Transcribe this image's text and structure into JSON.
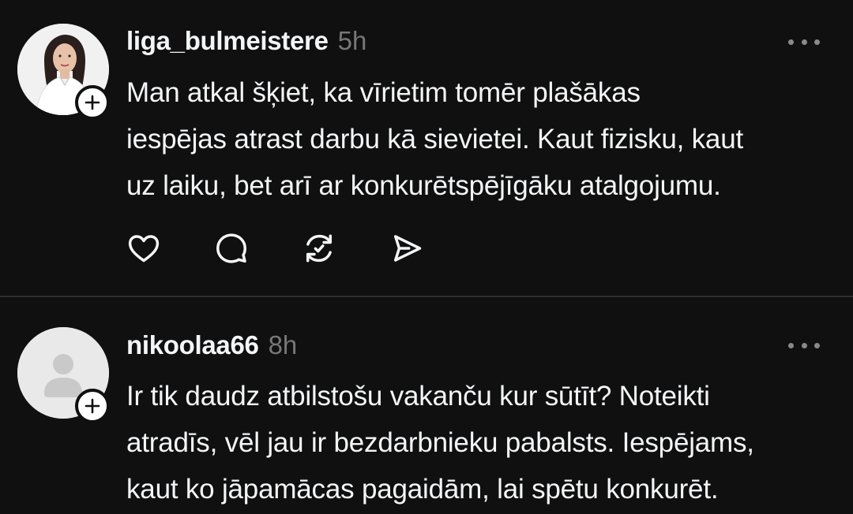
{
  "posts": [
    {
      "username": "liga_bulmeistere",
      "time": "5h",
      "avatar_icon": "user-photo-avatar",
      "text_lines": [
        "Man atkal šķiet, ka vīrietim tomēr plašākas",
        "iespējas atrast darbu kā sievietei. Kaut fizisku, kaut",
        "uz laiku, bet arī ar konkurētspējīgāku atalgojumu."
      ],
      "actions": [
        "heart-icon",
        "comment-icon",
        "repost-icon",
        "share-icon"
      ]
    },
    {
      "username": "nikoolaa66",
      "time": "8h",
      "avatar_icon": "default-user-avatar",
      "text_lines": [
        "Ir tik daudz atbilstošu vakanču kur sūtīt? Noteikti",
        "atradīs, vēl jau ir bezdarbnieku pabalsts. Iespējams,",
        "kaut ko jāpamācas pagaidām, lai spētu konkurēt."
      ]
    }
  ],
  "colors": {
    "background": "#101010",
    "text": "#f3f5f7",
    "muted": "#777777",
    "divider": "#2f2f2f"
  }
}
